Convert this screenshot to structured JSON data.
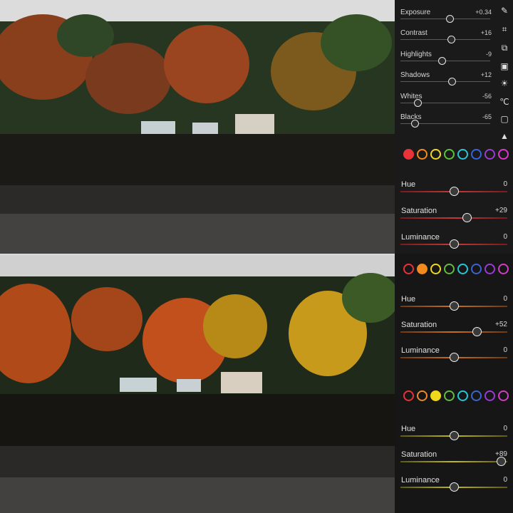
{
  "light_panel": {
    "sliders": [
      {
        "label": "Exposure",
        "value": "+0.34",
        "pos": 0.55
      },
      {
        "label": "Contrast",
        "value": "+16",
        "pos": 0.56
      },
      {
        "label": "Highlights",
        "value": "-9",
        "pos": 0.46
      },
      {
        "label": "Shadows",
        "value": "+12",
        "pos": 0.57
      },
      {
        "label": "Whites",
        "value": "-56",
        "pos": 0.19
      },
      {
        "label": "Blacks",
        "value": "-65",
        "pos": 0.16
      }
    ]
  },
  "tool_icons": [
    "brush-icon",
    "crop-icon",
    "layers-icon",
    "image-icon",
    "sun-icon",
    "thermometer-icon",
    "vignette-icon",
    "triangle-icon"
  ],
  "color_mixers": [
    {
      "selected_index": 0,
      "sliders": [
        {
          "label": "Hue",
          "value": "0",
          "pos": 0.5,
          "track": "red"
        },
        {
          "label": "Saturation",
          "value": "+29",
          "pos": 0.62,
          "track": "red"
        },
        {
          "label": "Luminance",
          "value": "0",
          "pos": 0.5,
          "track": "red"
        }
      ]
    },
    {
      "selected_index": 1,
      "sliders": [
        {
          "label": "Hue",
          "value": "0",
          "pos": 0.5,
          "track": "orange"
        },
        {
          "label": "Saturation",
          "value": "+52",
          "pos": 0.71,
          "track": "orange"
        },
        {
          "label": "Luminance",
          "value": "0",
          "pos": 0.5,
          "track": "orange"
        }
      ]
    },
    {
      "selected_index": 2,
      "sliders": [
        {
          "label": "Hue",
          "value": "0",
          "pos": 0.5,
          "track": "yellow"
        },
        {
          "label": "Saturation",
          "value": "+89",
          "pos": 0.94,
          "track": "yellow"
        },
        {
          "label": "Luminance",
          "value": "0",
          "pos": 0.5,
          "track": "yellow"
        }
      ]
    }
  ],
  "swatch_colors": [
    "#e8333a",
    "#f28a1e",
    "#f0d91c",
    "#5fbf3a",
    "#25c6d8",
    "#3a64d6",
    "#9b3ad6",
    "#d63ac8"
  ],
  "colors": {
    "accent": "#e8e8e8",
    "panel": "#161616"
  }
}
